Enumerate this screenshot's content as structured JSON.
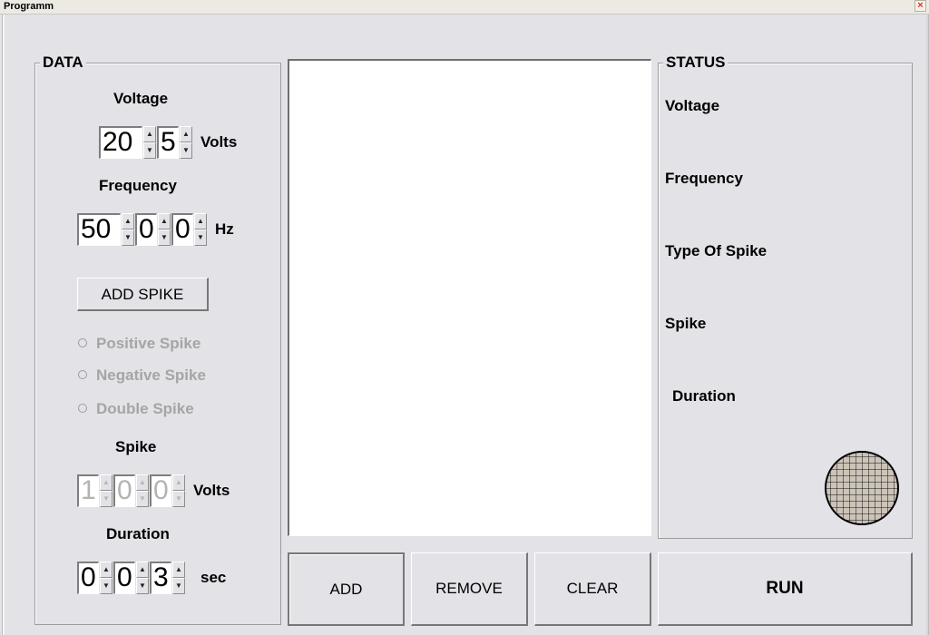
{
  "window": {
    "title": "Programm",
    "close_glyph": "×"
  },
  "data_panel": {
    "title": "DATA",
    "voltage": {
      "label": "Voltage",
      "fields": [
        "20",
        "5"
      ],
      "unit": "Volts"
    },
    "frequency": {
      "label": "Frequency",
      "fields": [
        "50",
        "0",
        "0"
      ],
      "unit": "Hz"
    },
    "add_spike_label": "ADD SPIKE",
    "spike_types": [
      "Positive Spike",
      "Negative Spike",
      "Double Spike"
    ],
    "spike": {
      "label": "Spike",
      "fields": [
        "1",
        "0",
        "0"
      ],
      "unit": "Volts"
    },
    "duration": {
      "label": "Duration",
      "fields": [
        "0",
        "0",
        "3"
      ],
      "unit": "sec"
    }
  },
  "status_panel": {
    "title": "STATUS",
    "labels": [
      "Voltage",
      "Frequency",
      "Type Of Spike",
      "Spike",
      "Duration"
    ]
  },
  "buttons": {
    "add": "ADD",
    "remove": "REMOVE",
    "clear": "CLEAR",
    "run": "RUN"
  },
  "spinner_arrows": {
    "up": "▲",
    "down": "▼"
  }
}
